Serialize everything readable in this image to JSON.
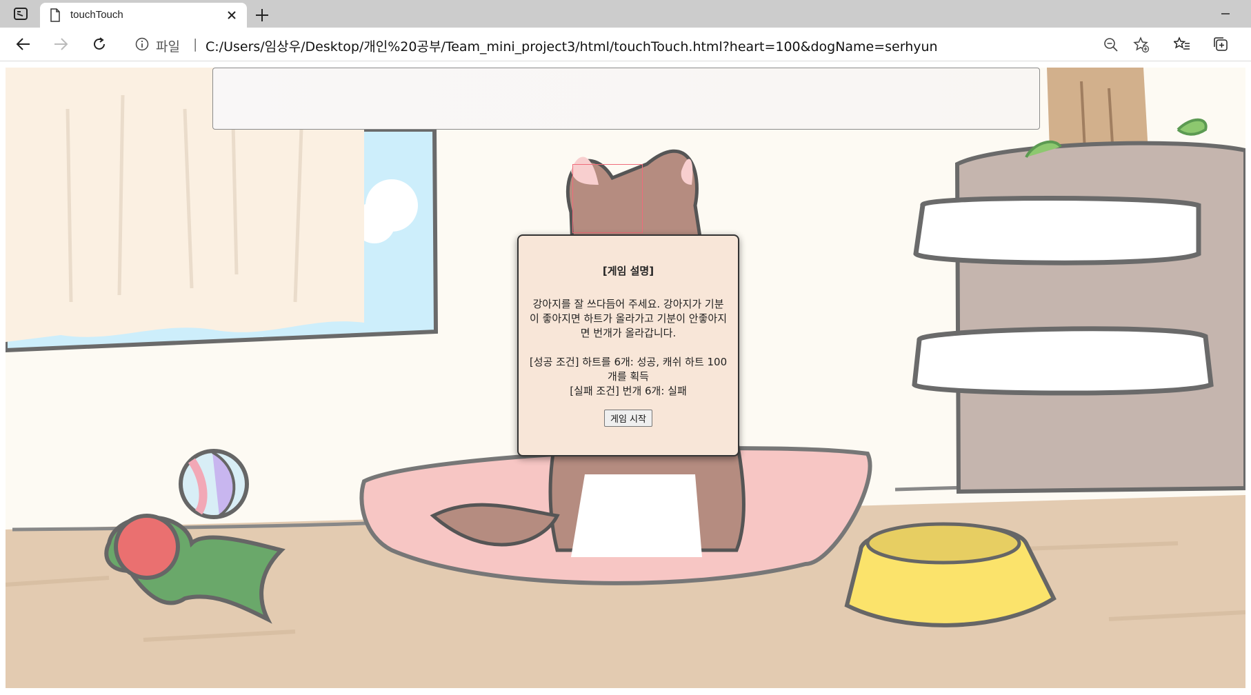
{
  "browser": {
    "tab_title": "touchTouch",
    "site_label": "파일",
    "separator": "|",
    "url": "C:/Users/임상우/Desktop/개인%20공부/Team_mini_project3/html/touchTouch.html?heart=100&dogName=serhyun"
  },
  "game": {
    "modal": {
      "title": "[게임 설명]",
      "description": "강아지를 잘 쓰다듬어 주세요. 강아지가 기분이 좋아지면 하트가 올라가고 기분이 안좋아지면 번개가 올라갑니다.",
      "success_rule": "[성공 조건] 하트를 6개: 성공, 캐쉬 하트 100개를 획득",
      "fail_rule": "[실패 조건] 번개 6개: 실패",
      "start_button": "게임 시작"
    }
  },
  "colors": {
    "floor": "#e3cbb1",
    "wall": "#fdfaf3",
    "cushion": "#f7c6c4",
    "dog_brown": "#b58c80",
    "bowl": "#fbe36b",
    "modal_bg": "#f8e6d8"
  },
  "icons": [
    "tab-actions-icon",
    "page-icon",
    "close-icon",
    "plus-icon",
    "minimize-icon",
    "back-arrow-icon",
    "forward-arrow-icon",
    "refresh-icon",
    "info-icon",
    "zoom-out-icon",
    "add-favorite-icon",
    "favorites-icon",
    "collections-icon"
  ]
}
